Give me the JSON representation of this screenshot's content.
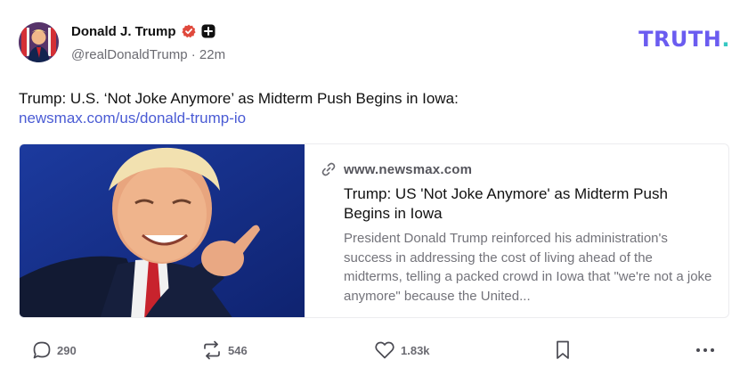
{
  "post": {
    "author_name": "Donald J. Trump",
    "handle": "@realDonaldTrump",
    "separator": "·",
    "time_ago": "22m",
    "verified_icon": "verified-badge-icon",
    "plus_icon": "plus-icon",
    "text": "Trump: U.S. ‘Not Joke Anymore’ as Midterm Push Begins in Iowa:",
    "link_text": "newsmax.com/us/donald-trump-io"
  },
  "brand": {
    "logo_text": "TRUTH",
    "logo_dot": ".",
    "primary_color": "#6b5cf0",
    "accent_color": "#36c8c2"
  },
  "card": {
    "domain": "www.newsmax.com",
    "title": "Trump: US 'Not Joke Anymore' as Midterm Push Begins in Iowa",
    "description": "President Donald Trump reinforced his administration's success in addressing the cost of living ahead of the midterms, telling a packed crowd in Iowa that \"we're not a joke anymore\" because the United..."
  },
  "actions": {
    "replies": "290",
    "retruths": "546",
    "likes": "1.83k"
  },
  "colors": {
    "link": "#4a5bd4",
    "verified": "#e0493c",
    "muted": "#6b6b72"
  }
}
